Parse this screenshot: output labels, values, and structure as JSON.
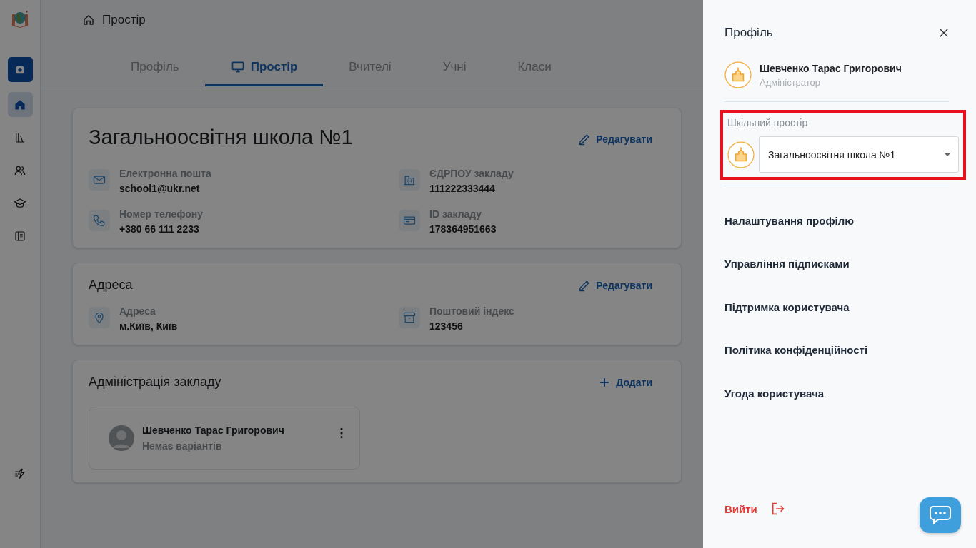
{
  "sidebar": {
    "items": [
      {
        "selected": true
      },
      {
        "selected": false
      },
      {
        "selected": false
      },
      {
        "selected": false
      },
      {
        "selected": false
      }
    ]
  },
  "breadcrumb": "Простір",
  "tabs": [
    {
      "label": "Профіль",
      "selected": false
    },
    {
      "label": "Простір",
      "selected": true
    },
    {
      "label": "Вчителі",
      "selected": false
    },
    {
      "label": "Учні",
      "selected": false
    },
    {
      "label": "Класи",
      "selected": false
    }
  ],
  "cards": [
    {
      "kind": "school",
      "title": "Загальноосвітня школа №1",
      "action": "Редагувати",
      "fields": [
        {
          "label": "Електронна пошта",
          "value": "school1@ukr.net"
        },
        {
          "label": "ЄДРПОУ закладу",
          "value": "111222333444"
        },
        {
          "label": "Номер телефону",
          "value": "+380 66 111 2233"
        },
        {
          "label": "ID закладу",
          "value": "178364951663"
        }
      ]
    },
    {
      "kind": "address",
      "title": "Адреса",
      "action": "Редагувати",
      "fields": [
        {
          "label": "Адреса",
          "value": "м.Київ, Київ"
        },
        {
          "label": "Поштовий індекс",
          "value": "123456"
        }
      ]
    },
    {
      "kind": "people",
      "title": "Адміністрація закладу",
      "action": "Додати",
      "people": [
        {
          "name": "Шевченко Тарас Григорович",
          "note": "Немає варіантів"
        }
      ]
    }
  ],
  "drawer": {
    "title": "Профіль",
    "user": {
      "name": "Шевченко Тарас Григорович",
      "role": "Адміністратор"
    },
    "space": {
      "label": "Шкільний простір",
      "value": "Загальноосвітня школа №1",
      "highlighted": true
    },
    "menu": [
      "Налаштування профілю",
      "Управління підписками",
      "Підтримка користувача",
      "Політика конфіденційності",
      "Угода користувача"
    ],
    "logout": "Вийти"
  }
}
